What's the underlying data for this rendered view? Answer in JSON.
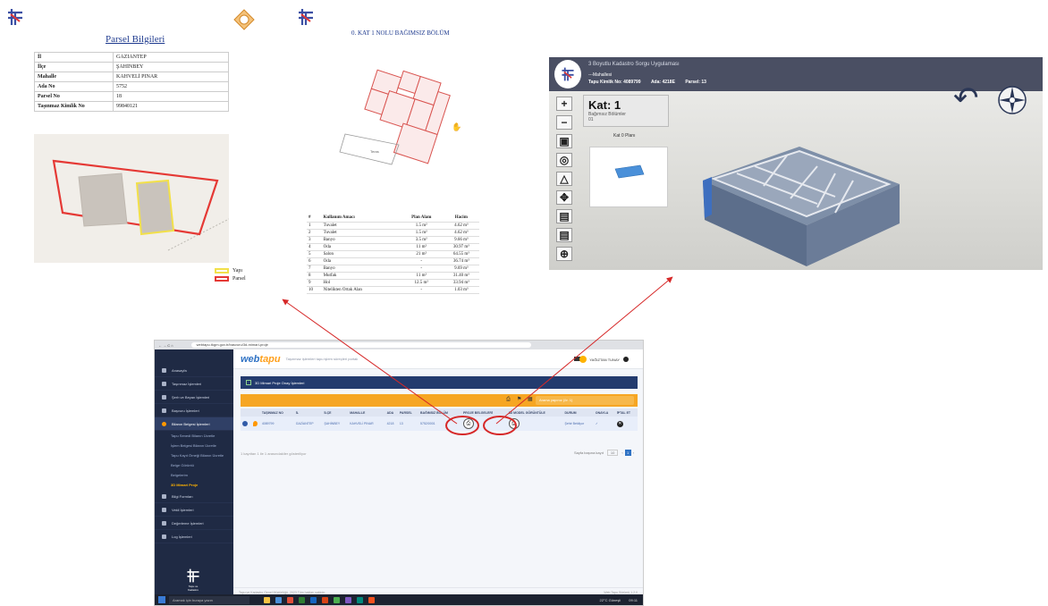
{
  "left_doc": {
    "title": "Parsel Bilgileri",
    "rows": [
      {
        "key": "İl",
        "value": "GAZIANTEP"
      },
      {
        "key": "İlçe",
        "value": "ŞAHİNBEY"
      },
      {
        "key": "Mahalle",
        "value": "KAHVELİ PINAR"
      },
      {
        "key": "Ada No",
        "value": "5752"
      },
      {
        "key": "Parsel No",
        "value": "18"
      },
      {
        "key": "Taşınmaz Kimlik No",
        "value": "99840121"
      }
    ],
    "legend": [
      {
        "label": "Yapı",
        "color": "#f2e04a"
      },
      {
        "label": "Parsel",
        "color": "#e53935"
      }
    ]
  },
  "mid_doc": {
    "title": "0. KAT 1 NOLU BAĞIMSIZ BÖLÜM",
    "plan_label": "Teras",
    "table": {
      "headers": [
        "#",
        "Kullanım Amacı",
        "Plan Alanı",
        "Hacim"
      ],
      "rows": [
        [
          "1",
          "Tuvalet",
          "1.5 m²",
          "4.62 m³"
        ],
        [
          "2",
          "Tuvalet",
          "1.5 m²",
          "4.62 m³"
        ],
        [
          "3",
          "Banyo",
          "3.5 m²",
          "9.66 m³"
        ],
        [
          "4",
          "Oda",
          "11 m²",
          "30.97 m³"
        ],
        [
          "5",
          "Salon",
          "21 m²",
          "64.55 m³"
        ],
        [
          "6",
          "Oda",
          "-",
          "36.74 m³"
        ],
        [
          "7",
          "Banyo",
          "-",
          "9.69 m³"
        ],
        [
          "8",
          "Mutfak",
          "11 m²",
          "31.40 m³"
        ],
        [
          "9",
          "Hol",
          "12.5 m²",
          "33.94 m³"
        ],
        [
          "10",
          "Nitelikten Ortak Alan",
          "-",
          "1.03 m³"
        ]
      ]
    }
  },
  "viewer": {
    "app_title": "3 Boyutlu Kadastro Sorgu Uygulaması",
    "mahalle_label": "---Mahallesi",
    "meta": [
      {
        "label": "Tapu Kimlik No:",
        "value": "4089799"
      },
      {
        "label": "Ada:",
        "value": "4218E"
      },
      {
        "label": "Parsel:",
        "value": "13"
      }
    ],
    "kat_title": "Kat: 1",
    "kat_sub1": "Bağımsız Bölümler",
    "kat_sub2": "01",
    "kat_plan_label": "Kat 0 Planı",
    "tools": [
      "+",
      "−",
      "▣",
      "◎",
      "△",
      "✥",
      "▤",
      "▤",
      "⊕"
    ]
  },
  "browser": {
    "url": "webtapu.tkgm.gov.tr/basvuru/3d-mimari-proje",
    "brand_main": "web",
    "brand_accent": "tapu",
    "brand_sub": "Taşınmaz işlemleri tapu işlem süreçleri portalı",
    "user_name": "YAĞIZTAN TUNAY",
    "sidebar": [
      {
        "label": "Anasayfa",
        "active": false
      },
      {
        "label": "Taşınmaz İşlemleri",
        "active": false
      },
      {
        "label": "Şerh ve Beyan İşlemleri",
        "active": false
      },
      {
        "label": "Başvuru İşlemleri",
        "active": false
      },
      {
        "label": "Bilanın Belgesi İşlemleri",
        "active": true
      }
    ],
    "sidebar_sub": [
      {
        "label": "Tapu Senedi Bilanın Ücretle",
        "active": false
      },
      {
        "label": "İşlem Belgesi Bilanın Ücretle",
        "active": false
      },
      {
        "label": "Tapu Kayıt Örneği Bilanın Ücretle",
        "active": false
      },
      {
        "label": "Belge Görüntü",
        "active": false
      },
      {
        "label": "Belgelerim",
        "active": false
      },
      {
        "label": "3D Mimari Proje",
        "active": true
      }
    ],
    "sidebar_bottom": [
      {
        "label": "Bilgi Formları"
      },
      {
        "label": "Vekil İşlemleri"
      },
      {
        "label": "Değerleme İşlemleri"
      },
      {
        "label": "Log İşlemleri"
      }
    ],
    "sidebar_logo_text": "Tapu ve Kadastro",
    "panel_title": "3D Mimari Proje Onay İşlemleri",
    "search_placeholder": "Arama yapınız (ör. 1)",
    "grid_headers": [
      "",
      "",
      "TAŞINMAZ NO",
      "İL",
      "İLÇE",
      "MAHALLE",
      "ADA",
      "PARSEL",
      "BAĞIMSIZ BÖLÜM",
      "PROJE BELGELERİ",
      "3D MODEL GÖRÜNTÜLE",
      "DURUM",
      "ONAYLA",
      "İPTAL ET"
    ],
    "grid_row": [
      "",
      "",
      "4089799",
      "GAZİANTEP",
      "ŞAHİNBEY",
      "KAHVELİ PINAR",
      "4218",
      "13",
      "5752/0001",
      "",
      "",
      "Şehir Bekliyor",
      "✓",
      ""
    ],
    "showing_text": "1 kayıttan 1 ile 1 arasındakiler gösteriliyor",
    "pager_label": "Sayfa başına kayıt",
    "pager_size": "10",
    "pager_page": "1",
    "footer": "Tapu ve Kadastro Genel Müdürlüğü, 2023 Tüm hakları saklıdır.",
    "footer_right": "Web Tapu Sürümü 1.2.0",
    "taskbar_search": "Aramak için buraya yazın",
    "taskbar_weather": "22°C Güneşli",
    "taskbar_time": "09:11"
  },
  "colors": {
    "highlight": "#d62828",
    "arrow": "#d62828",
    "navy": "#1f2a44",
    "orange": "#f6a623"
  }
}
